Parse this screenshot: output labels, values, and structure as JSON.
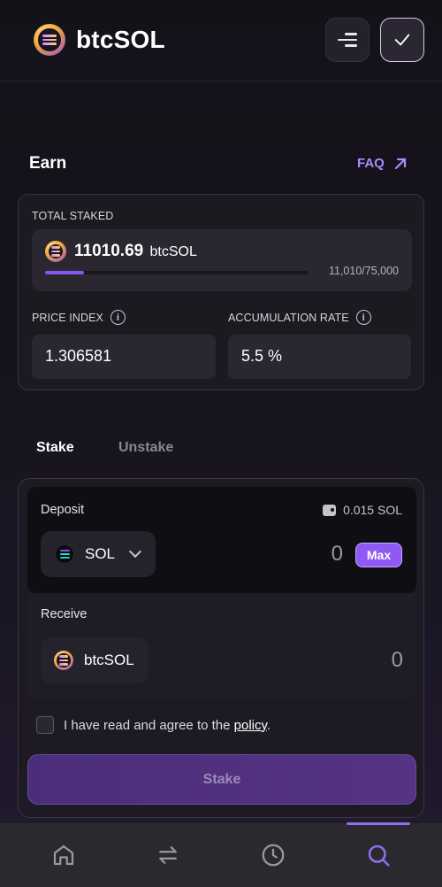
{
  "header": {
    "brand": "btcSOL",
    "menu_icon": "menu-icon",
    "check_icon": "check-icon"
  },
  "earn": {
    "title": "Earn",
    "faq_label": "FAQ"
  },
  "stats": {
    "total_staked_label": "TOTAL STAKED",
    "total_staked_amount": "11010.69",
    "total_staked_unit": "btcSOL",
    "progress_text": "11,010/75,000",
    "progress_fraction": 0.1468,
    "price_index_label": "PRICE INDEX",
    "price_index_value": "1.306581",
    "accumulation_label": "ACCUMULATION RATE",
    "accumulation_value": "5.5 %"
  },
  "tabs": {
    "stake": "Stake",
    "unstake": "Unstake"
  },
  "deposit": {
    "label": "Deposit",
    "balance": "0.015 SOL",
    "token": "SOL",
    "amount": "0",
    "max_label": "Max"
  },
  "receive": {
    "label": "Receive",
    "token": "btcSOL",
    "amount": "0"
  },
  "agreement": {
    "text": "I have read and agree to the",
    "link": "policy",
    "suffix": "."
  },
  "stake_button": "Stake",
  "colors": {
    "accent": "#8e5af3",
    "link": "#a98bff"
  },
  "nav": {
    "items": [
      "home-icon",
      "swap-icon",
      "history-icon",
      "search-icon"
    ],
    "active": "search-icon"
  }
}
